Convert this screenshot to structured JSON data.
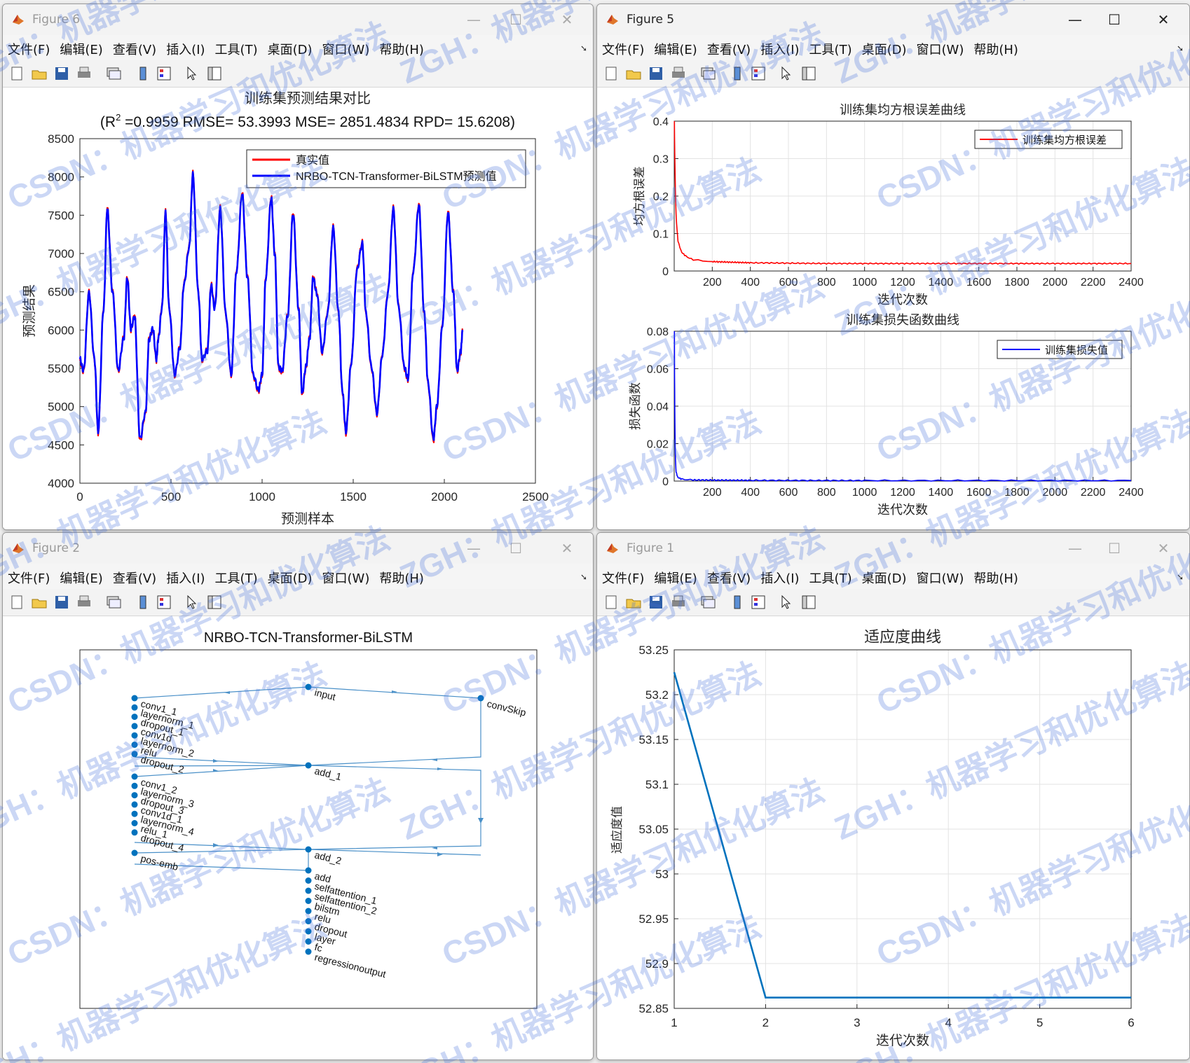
{
  "menu": [
    "文件(F)",
    "编辑(E)",
    "查看(V)",
    "插入(I)",
    "工具(T)",
    "桌面(D)",
    "窗口(W)",
    "帮助(H)"
  ],
  "window_controls": {
    "minimize": "—",
    "maximize": "☐",
    "close": "✕"
  },
  "fig6": {
    "title": "Figure 6",
    "plot_title": "训练集预测结果对比",
    "plot_subtitle_pre": "(R",
    "plot_subtitle_sup": "2",
    "plot_subtitle_post": " =0.9959 RMSE= 53.3993 MSE= 2851.4834 RPD= 15.6208)",
    "ylabel": "预测结果",
    "xlabel": "预测样本",
    "legend": [
      "真实值",
      "NRBO-TCN-Transformer-BiLSTM预测值"
    ],
    "xticks": [
      "0",
      "500",
      "1000",
      "1500",
      "2000",
      "2500"
    ],
    "yticks": [
      "4000",
      "4500",
      "5000",
      "5500",
      "6000",
      "6500",
      "7000",
      "7500",
      "8000",
      "8500"
    ]
  },
  "fig5": {
    "title": "Figure 5",
    "top": {
      "title": "训练集均方根误差曲线",
      "ylabel": "均方根误差",
      "xlabel": "迭代次数",
      "legend": "训练集均方根误差",
      "yticks": [
        "0",
        "0.1",
        "0.2",
        "0.3",
        "0.4"
      ]
    },
    "bottom": {
      "title": "训练集损失函数曲线",
      "ylabel": "损失函数",
      "xlabel": "迭代次数",
      "legend": "训练集损失值",
      "yticks": [
        "0",
        "0.02",
        "0.04",
        "0.06",
        "0.08"
      ]
    },
    "xticks": [
      "200",
      "400",
      "600",
      "800",
      "1000",
      "1200",
      "1400",
      "1600",
      "1800",
      "2000",
      "2200",
      "2400"
    ]
  },
  "fig2": {
    "title": "Figure 2",
    "plot_title": "NRBO-TCN-Transformer-BiLSTM",
    "nodes": {
      "input": "input",
      "convSkip": "convSkip",
      "add_1": "add_1",
      "add_2": "add_2",
      "pos_emb": "pos-emb",
      "left1": [
        "conv1_1",
        "layernorm_1",
        "dropout_1",
        "conv1d",
        "layernorm_2",
        "relu",
        "dropout_2"
      ],
      "left2": [
        "conv1_2",
        "layernorm_3",
        "dropout_3",
        "conv1d_1",
        "layernorm_4",
        "relu_1",
        "dropout_4"
      ],
      "bottom": [
        "add",
        "selfattention_1",
        "selfattention_2",
        "bilstm",
        "relu",
        "dropout",
        "layer",
        "fc",
        "regressionoutput"
      ]
    }
  },
  "fig1": {
    "title": "Figure 1",
    "plot_title": "适应度曲线",
    "ylabel": "适应度值",
    "xlabel": "迭代次数",
    "xticks": [
      "1",
      "2",
      "3",
      "4",
      "5",
      "6"
    ],
    "yticks": [
      "52.85",
      "52.9",
      "52.95",
      "53",
      "53.05",
      "53.1",
      "53.15",
      "53.2",
      "53.25"
    ]
  },
  "watermark": [
    "ZGH：机器学习和优化算法",
    "CSDN：机器学习和优化算法"
  ],
  "colors": {
    "true_line": "#ff0000",
    "pred_line": "#0000ff",
    "fitness_line": "#0072bd",
    "graph": "#4a90c8",
    "node": "#0072bd"
  },
  "chart_data": [
    {
      "type": "line",
      "title": "训练集预测结果对比",
      "xlabel": "预测样本",
      "ylabel": "预测结果",
      "xlim": [
        0,
        2500
      ],
      "ylim": [
        4000,
        8500
      ],
      "series": [
        {
          "name": "真实值",
          "x": [
            0,
            20,
            50,
            80,
            100,
            130,
            150,
            180,
            210,
            240,
            260,
            280,
            300,
            330,
            360,
            380,
            400,
            420,
            430,
            450,
            470,
            490,
            520,
            550,
            570,
            600,
            620,
            650,
            670,
            700,
            720,
            740,
            770,
            800,
            830,
            860,
            890,
            920,
            950,
            980,
            1000,
            1020,
            1050,
            1070,
            1090,
            1110,
            1140,
            1170,
            1200,
            1220,
            1240,
            1260,
            1280,
            1300,
            1330,
            1360,
            1390,
            1420,
            1440,
            1460,
            1490,
            1520,
            1550,
            1570,
            1600,
            1630,
            1660,
            1690,
            1720,
            1750,
            1780,
            1800,
            1830,
            1860,
            1890,
            1910,
            1940,
            1960,
            1990,
            2020,
            2050,
            2070,
            2090,
            2100
          ],
          "y": [
            5600,
            5450,
            6500,
            5600,
            4650,
            6300,
            7600,
            6500,
            5450,
            5900,
            6700,
            6000,
            6200,
            4550,
            4900,
            5900,
            6000,
            5600,
            5900,
            6300,
            7550,
            6300,
            5400,
            5800,
            6600,
            7100,
            8050,
            6500,
            5600,
            5750,
            6600,
            6300,
            7600,
            6200,
            5400,
            6800,
            7800,
            6700,
            5400,
            5200,
            5400,
            6700,
            7750,
            7000,
            5500,
            5450,
            6200,
            7550,
            6300,
            5150,
            5500,
            5900,
            6700,
            6500,
            5700,
            6250,
            7350,
            6200,
            5200,
            4650,
            5600,
            6800,
            7150,
            6200,
            5500,
            4900,
            5700,
            6500,
            7600,
            6300,
            5500,
            5350,
            6800,
            7650,
            6200,
            5300,
            4550,
            5000,
            6100,
            7550,
            6500,
            5450,
            5700,
            6000
          ]
        },
        {
          "name": "NRBO-TCN-Transformer-BiLSTM预测值",
          "x": [
            0,
            20,
            50,
            80,
            100,
            130,
            150,
            180,
            210,
            240,
            260,
            280,
            300,
            330,
            360,
            380,
            400,
            420,
            430,
            450,
            470,
            490,
            520,
            550,
            570,
            600,
            620,
            650,
            670,
            700,
            720,
            740,
            770,
            800,
            830,
            860,
            890,
            920,
            950,
            980,
            1000,
            1020,
            1050,
            1070,
            1090,
            1110,
            1140,
            1170,
            1200,
            1220,
            1240,
            1260,
            1280,
            1300,
            1330,
            1360,
            1390,
            1420,
            1440,
            1460,
            1490,
            1520,
            1550,
            1570,
            1600,
            1630,
            1660,
            1690,
            1720,
            1750,
            1780,
            1800,
            1830,
            1860,
            1890,
            1910,
            1940,
            1960,
            1990,
            2020,
            2050,
            2070,
            2090,
            2100
          ],
          "y": [
            5620,
            5470,
            6480,
            5620,
            4680,
            6280,
            7580,
            6480,
            5470,
            5880,
            6680,
            6020,
            6180,
            4580,
            4920,
            5880,
            6020,
            5620,
            5880,
            6280,
            7530,
            6280,
            5420,
            5780,
            6580,
            7080,
            8030,
            6480,
            5620,
            5730,
            6580,
            6280,
            7580,
            6220,
            5420,
            6780,
            7780,
            6680,
            5420,
            5220,
            5420,
            6680,
            7730,
            6980,
            5520,
            5470,
            6180,
            7530,
            6280,
            5170,
            5520,
            5880,
            6680,
            6480,
            5720,
            6230,
            7330,
            6220,
            5220,
            4680,
            5580,
            6780,
            7130,
            6220,
            5520,
            4920,
            5680,
            6480,
            7580,
            6280,
            5520,
            5370,
            6780,
            7630,
            6220,
            5320,
            4580,
            5020,
            6080,
            7530,
            6480,
            5470,
            5720,
            5980
          ]
        }
      ]
    },
    {
      "type": "line",
      "title": "训练集均方根误差曲线",
      "xlabel": "迭代次数",
      "ylabel": "均方根误差",
      "xlim": [
        0,
        2400
      ],
      "ylim": [
        0,
        0.4
      ],
      "series": [
        {
          "name": "训练集均方根误差",
          "x": [
            1,
            5,
            10,
            20,
            40,
            60,
            100,
            200,
            400,
            800,
            1200,
            1600,
            2000,
            2400
          ],
          "y": [
            0.4,
            0.25,
            0.15,
            0.08,
            0.05,
            0.04,
            0.03,
            0.025,
            0.022,
            0.02,
            0.02,
            0.02,
            0.02,
            0.02
          ]
        }
      ]
    },
    {
      "type": "line",
      "title": "训练集损失函数曲线",
      "xlabel": "迭代次数",
      "ylabel": "损失函数",
      "xlim": [
        0,
        2400
      ],
      "ylim": [
        0,
        0.08
      ],
      "series": [
        {
          "name": "训练集损失值",
          "x": [
            1,
            3,
            6,
            10,
            20,
            40,
            100,
            400,
            1000,
            2400
          ],
          "y": [
            0.08,
            0.04,
            0.015,
            0.005,
            0.002,
            0.001,
            0.0006,
            0.0004,
            0.0003,
            0.0003
          ]
        }
      ]
    },
    {
      "type": "line",
      "title": "适应度曲线",
      "xlabel": "迭代次数",
      "ylabel": "适应度值",
      "xlim": [
        1,
        6
      ],
      "ylim": [
        52.85,
        53.25
      ],
      "series": [
        {
          "x": [
            1,
            2,
            3,
            4,
            5,
            6
          ],
          "y": [
            53.225,
            52.862,
            52.862,
            52.862,
            52.862,
            52.862
          ]
        }
      ]
    }
  ]
}
